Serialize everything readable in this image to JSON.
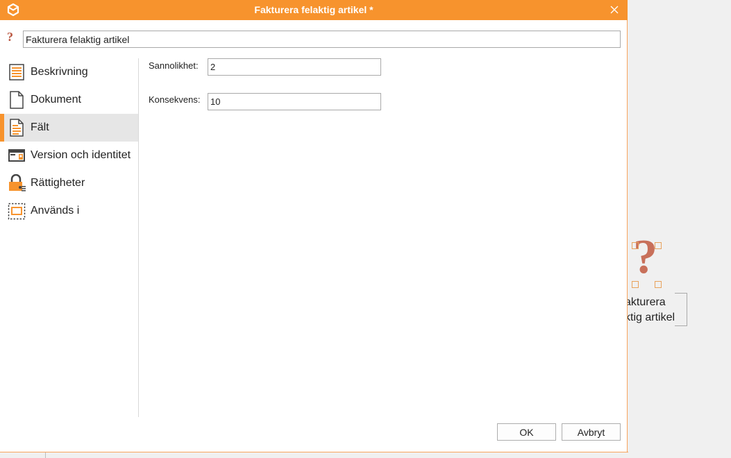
{
  "window": {
    "title": "Fakturera felaktig artikel *",
    "accent_color": "#f7932d"
  },
  "name_field": {
    "value": "Fakturera felaktig artikel",
    "icon": "question-mark-icon"
  },
  "sidebar": {
    "items": [
      {
        "label": "Beskrivning",
        "icon": "description-icon",
        "active": false
      },
      {
        "label": "Dokument",
        "icon": "document-icon",
        "active": false
      },
      {
        "label": "Fält",
        "icon": "fields-icon",
        "active": true
      },
      {
        "label": "Version och identitet",
        "icon": "version-identity-icon",
        "active": false
      },
      {
        "label": "Rättigheter",
        "icon": "lock-icon",
        "active": false
      },
      {
        "label": "Används i",
        "icon": "used-in-icon",
        "active": false
      }
    ]
  },
  "fields": {
    "probability": {
      "label": "Sannolikhet:",
      "value": "2"
    },
    "consequence": {
      "label": "Konsekvens:",
      "value": "10"
    }
  },
  "buttons": {
    "ok": "OK",
    "cancel": "Avbryt"
  },
  "background": {
    "node_label_line1": "akturera",
    "node_label_line2": "ktig artikel"
  }
}
